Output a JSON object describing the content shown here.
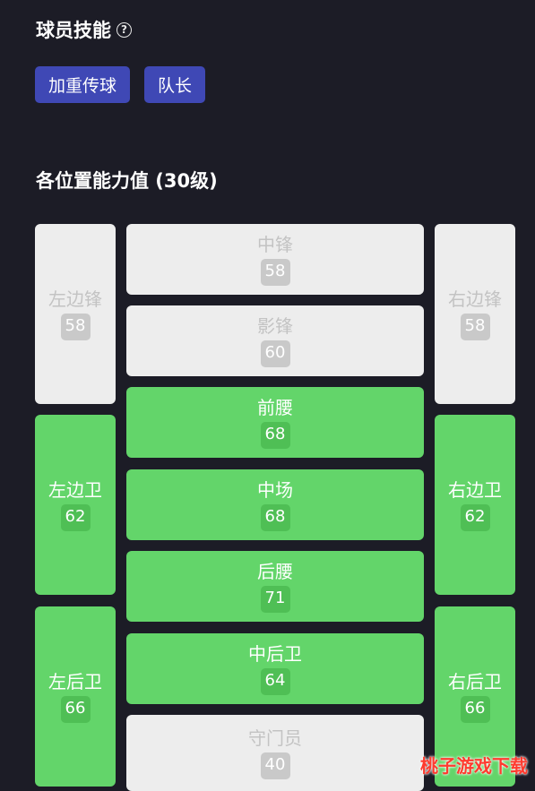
{
  "skills": {
    "title": "球员技能",
    "tags": [
      "加重传球",
      "队长"
    ]
  },
  "positions": {
    "title": "各位置能力值 (30级)",
    "cells": [
      {
        "name": "左边锋",
        "value": "58",
        "active": false
      },
      {
        "name": "中锋",
        "value": "58",
        "active": false
      },
      {
        "name": "右边锋",
        "value": "58",
        "active": false
      },
      {
        "name": "影锋",
        "value": "60",
        "active": false
      },
      {
        "name": "前腰",
        "value": "68",
        "active": true
      },
      {
        "name": "左边卫",
        "value": "62",
        "active": true
      },
      {
        "name": "中场",
        "value": "68",
        "active": true
      },
      {
        "name": "右边卫",
        "value": "62",
        "active": true
      },
      {
        "name": "后腰",
        "value": "71",
        "active": true
      },
      {
        "name": "左后卫",
        "value": "66",
        "active": true
      },
      {
        "name": "中后卫",
        "value": "64",
        "active": true
      },
      {
        "name": "右后卫",
        "value": "66",
        "active": true
      },
      {
        "name": "守门员",
        "value": "40",
        "active": false
      }
    ]
  },
  "watermark": "桃子游戏下载",
  "colors": {
    "background": "#1c1c26",
    "tag": "#3f48b5",
    "active": "#63d56a",
    "inactive": "#ededed"
  }
}
